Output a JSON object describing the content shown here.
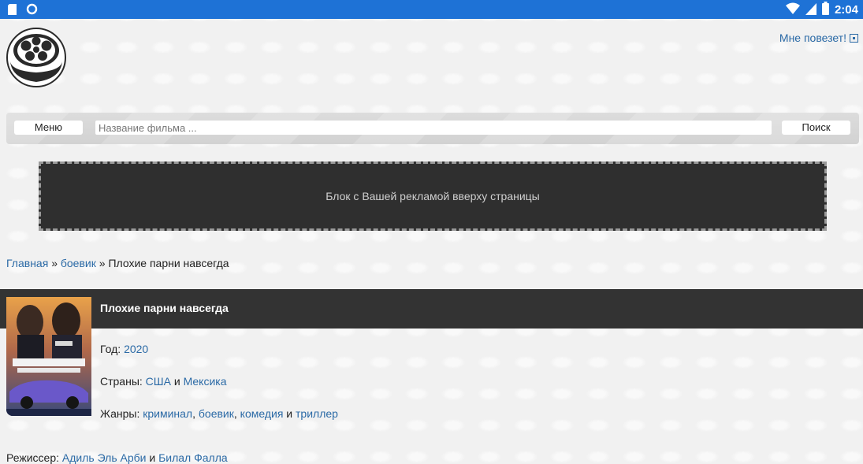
{
  "status_bar": {
    "time": "2:04",
    "left_icons": [
      "sd-card-icon",
      "circle-icon"
    ],
    "right_icons": [
      "wifi-icon",
      "signal-icon",
      "battery-icon"
    ]
  },
  "header": {
    "logo_icon": "film-reel-icon",
    "lucky_link": "Мне повезет!"
  },
  "search_bar": {
    "menu_label": "Меню",
    "placeholder": "Название фильма ...",
    "search_label": "Поиск"
  },
  "ad_block": {
    "text": "Блок с Вашей рекламой вверху страницы"
  },
  "breadcrumb": {
    "home": "Главная",
    "sep1": "»",
    "category": "боевик",
    "sep2": "»",
    "current": "Плохие парни навсегда"
  },
  "movie": {
    "title": "Плохие парни навсегда",
    "year_label": "Год:",
    "year": "2020",
    "countries_label": "Страны:",
    "countries": [
      "США",
      "Мексика"
    ],
    "and": "и",
    "genres_label": "Жанры:",
    "genres": [
      "криминал",
      "боевик",
      "комедия",
      "триллер"
    ],
    "director_label": "Режиссер:",
    "directors": [
      "Адиль Эль Арби",
      "Билал Фалла"
    ]
  },
  "colors": {
    "status_bar": "#1e72d6",
    "link": "#2b6aa6",
    "dark_band": "#333333"
  }
}
